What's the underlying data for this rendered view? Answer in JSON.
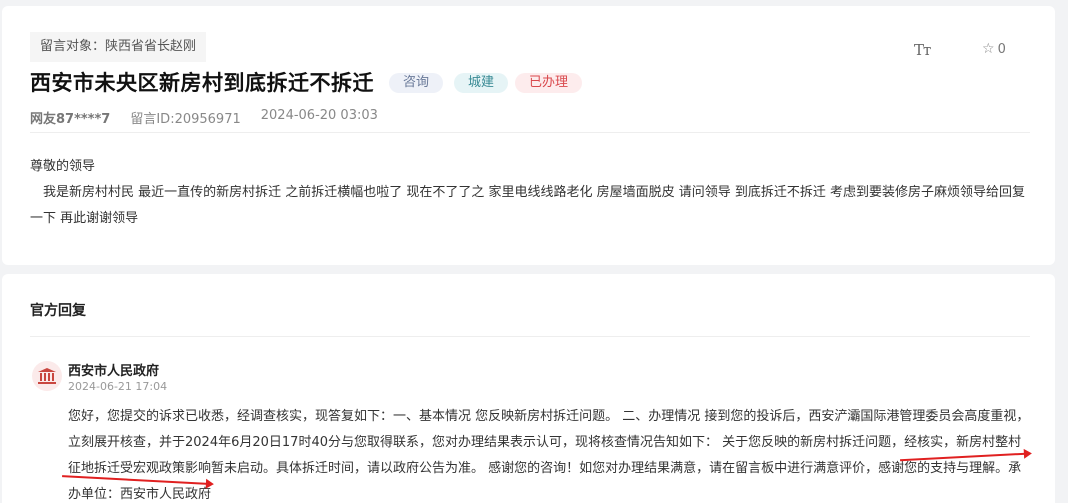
{
  "message": {
    "target": "留言对象：陕西省省长赵刚",
    "title": "西安市未央区新房村到底拆迁不拆迁",
    "tags": [
      "咨询",
      "城建",
      "已办理"
    ],
    "font_toggle": "Tт",
    "favorite_count": "0",
    "user": "网友87****7",
    "message_id": "留言ID:20956971",
    "time": "2024-06-20 03:03",
    "greeting": "尊敬的领导",
    "content": "我是新房村村民  最近一直传的新房村拆迁  之前拆迁横幅也啦了  现在不了了之    家里电线线路老化 房屋墙面脱皮 请问领导 到底拆迁不拆迁  考虑到要装修房子麻烦领导给回复一下   再此谢谢领导"
  },
  "reply": {
    "section_title": "官方回复",
    "org_name": "西安市人民政府",
    "time": "2024-06-21 17:04",
    "content": "您好，您提交的诉求已收悉，经调查核实，现答复如下：一、基本情况 您反映新房村拆迁问题。 二、办理情况 接到您的投诉后，西安浐灞国际港管理委员会高度重视，立刻展开核查，并于2024年6月20日17时40分与您取得联系，您对办理结果表示认可，现将核查情况告知如下： 关于您反映的新房村拆迁问题，经核实，新房村整村征地拆迁受宏观政策影响暂未启动。具体拆迁时间，请以政府公告为准。 感谢您的咨询！如您对办理结果满意，请在留言板中进行满意评价，感谢您的支持与理解。承办单位：西安市人民政府"
  },
  "colors": {
    "annotation_arrow": "#e02020",
    "tag_done": "#d9494d"
  }
}
